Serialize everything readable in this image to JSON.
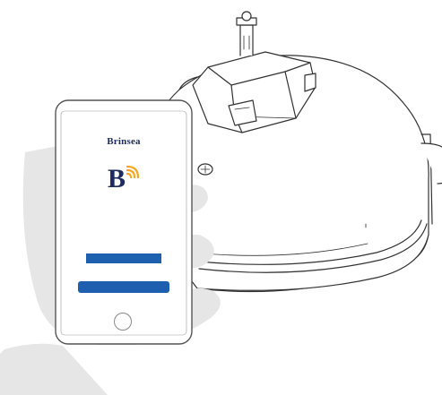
{
  "app": {
    "brand_name": "Brinsea",
    "brand_tagline": "",
    "logo_letter": "B",
    "logo_icon": "wifi-signal-icon",
    "welcome_title": "",
    "description": "",
    "primary_button_label": "",
    "secondary_button_label": "",
    "home_button_icon": "home-button-icon"
  },
  "colors": {
    "brand_navy": "#1f2b5c",
    "brand_gold": "#c9a23a",
    "wifi_orange": "#f5a623",
    "button_blue": "#1f5fb0",
    "hand_gray": "#e6e6e6",
    "outline": "#333333"
  },
  "illustration": {
    "device": "incubator-dome-icon",
    "hand": "hand-holding-phone-icon"
  }
}
